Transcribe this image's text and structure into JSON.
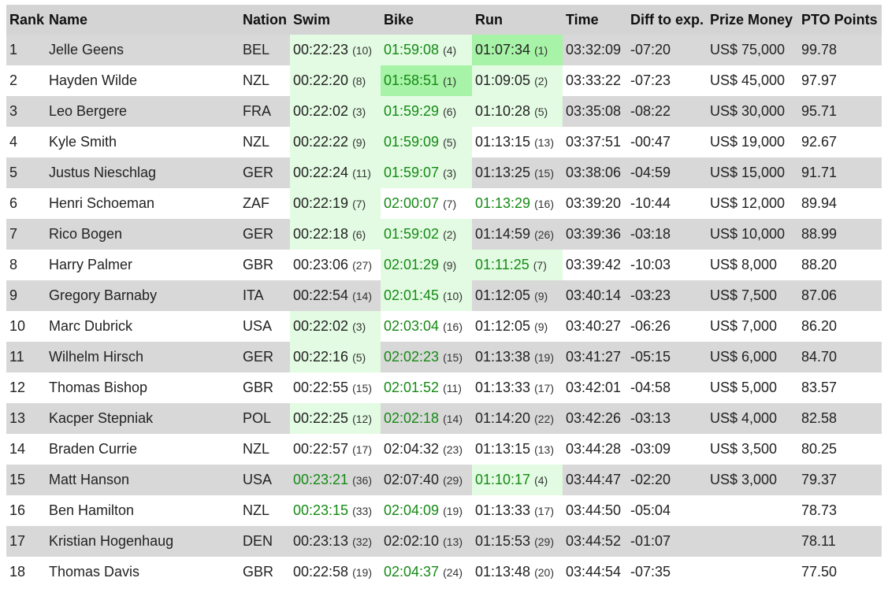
{
  "headers": {
    "rank": "Rank",
    "name": "Name",
    "nation": "Nation",
    "swim": "Swim",
    "bike": "Bike",
    "run": "Run",
    "time": "Time",
    "diff": "Diff to exp.",
    "prize": "Prize Money",
    "pto": "PTO Points"
  },
  "rows": [
    {
      "rank": "1",
      "name": "Jelle Geens",
      "nation": "BEL",
      "swim": "00:22:23",
      "swim_pos": "(10)",
      "bike": "01:59:08",
      "bike_pos": "(4)",
      "run": "01:07:34",
      "run_pos": "(1)",
      "time": "03:32:09",
      "diff": "-07:20",
      "prize": "US$ 75,000",
      "pto": "99.78"
    },
    {
      "rank": "2",
      "name": "Hayden Wilde",
      "nation": "NZL",
      "swim": "00:22:20",
      "swim_pos": "(8)",
      "bike": "01:58:51",
      "bike_pos": "(1)",
      "run": "01:09:05",
      "run_pos": "(2)",
      "time": "03:33:22",
      "diff": "-07:23",
      "prize": "US$ 45,000",
      "pto": "97.97"
    },
    {
      "rank": "3",
      "name": "Leo Bergere",
      "nation": "FRA",
      "swim": "00:22:02",
      "swim_pos": "(3)",
      "bike": "01:59:29",
      "bike_pos": "(6)",
      "run": "01:10:28",
      "run_pos": "(5)",
      "time": "03:35:08",
      "diff": "-08:22",
      "prize": "US$ 30,000",
      "pto": "95.71"
    },
    {
      "rank": "4",
      "name": "Kyle Smith",
      "nation": "NZL",
      "swim": "00:22:22",
      "swim_pos": "(9)",
      "bike": "01:59:09",
      "bike_pos": "(5)",
      "run": "01:13:15",
      "run_pos": "(13)",
      "time": "03:37:51",
      "diff": "-00:47",
      "prize": "US$ 19,000",
      "pto": "92.67"
    },
    {
      "rank": "5",
      "name": "Justus Nieschlag",
      "nation": "GER",
      "swim": "00:22:24",
      "swim_pos": "(11)",
      "bike": "01:59:07",
      "bike_pos": "(3)",
      "run": "01:13:25",
      "run_pos": "(15)",
      "time": "03:38:06",
      "diff": "-04:59",
      "prize": "US$ 15,000",
      "pto": "91.71"
    },
    {
      "rank": "6",
      "name": "Henri Schoeman",
      "nation": "ZAF",
      "swim": "00:22:19",
      "swim_pos": "(7)",
      "bike": "02:00:07",
      "bike_pos": "(7)",
      "run": "01:13:29",
      "run_pos": "(16)",
      "time": "03:39:20",
      "diff": "-10:44",
      "prize": "US$ 12,000",
      "pto": "89.94"
    },
    {
      "rank": "7",
      "name": "Rico Bogen",
      "nation": "GER",
      "swim": "00:22:18",
      "swim_pos": "(6)",
      "bike": "01:59:02",
      "bike_pos": "(2)",
      "run": "01:14:59",
      "run_pos": "(26)",
      "time": "03:39:36",
      "diff": "-03:18",
      "prize": "US$ 10,000",
      "pto": "88.99"
    },
    {
      "rank": "8",
      "name": "Harry Palmer",
      "nation": "GBR",
      "swim": "00:23:06",
      "swim_pos": "(27)",
      "bike": "02:01:29",
      "bike_pos": "(9)",
      "run": "01:11:25",
      "run_pos": "(7)",
      "time": "03:39:42",
      "diff": "-10:03",
      "prize": "US$ 8,000",
      "pto": "88.20"
    },
    {
      "rank": "9",
      "name": "Gregory Barnaby",
      "nation": "ITA",
      "swim": "00:22:54",
      "swim_pos": "(14)",
      "bike": "02:01:45",
      "bike_pos": "(10)",
      "run": "01:12:05",
      "run_pos": "(9)",
      "time": "03:40:14",
      "diff": "-03:23",
      "prize": "US$ 7,500",
      "pto": "87.06"
    },
    {
      "rank": "10",
      "name": "Marc Dubrick",
      "nation": "USA",
      "swim": "00:22:02",
      "swim_pos": "(3)",
      "bike": "02:03:04",
      "bike_pos": "(16)",
      "run": "01:12:05",
      "run_pos": "(9)",
      "time": "03:40:27",
      "diff": "-06:26",
      "prize": "US$ 7,000",
      "pto": "86.20"
    },
    {
      "rank": "11",
      "name": "Wilhelm Hirsch",
      "nation": "GER",
      "swim": "00:22:16",
      "swim_pos": "(5)",
      "bike": "02:02:23",
      "bike_pos": "(15)",
      "run": "01:13:38",
      "run_pos": "(19)",
      "time": "03:41:27",
      "diff": "-05:15",
      "prize": "US$ 6,000",
      "pto": "84.70"
    },
    {
      "rank": "12",
      "name": "Thomas Bishop",
      "nation": "GBR",
      "swim": "00:22:55",
      "swim_pos": "(15)",
      "bike": "02:01:52",
      "bike_pos": "(11)",
      "run": "01:13:33",
      "run_pos": "(17)",
      "time": "03:42:01",
      "diff": "-04:58",
      "prize": "US$ 5,000",
      "pto": "83.57"
    },
    {
      "rank": "13",
      "name": "Kacper Stepniak",
      "nation": "POL",
      "swim": "00:22:25",
      "swim_pos": "(12)",
      "bike": "02:02:18",
      "bike_pos": "(14)",
      "run": "01:14:20",
      "run_pos": "(22)",
      "time": "03:42:26",
      "diff": "-03:13",
      "prize": "US$ 4,000",
      "pto": "82.58"
    },
    {
      "rank": "14",
      "name": "Braden Currie",
      "nation": "NZL",
      "swim": "00:22:57",
      "swim_pos": "(17)",
      "bike": "02:04:32",
      "bike_pos": "(23)",
      "run": "01:13:15",
      "run_pos": "(13)",
      "time": "03:44:28",
      "diff": "-03:09",
      "prize": "US$ 3,500",
      "pto": "80.25"
    },
    {
      "rank": "15",
      "name": "Matt Hanson",
      "nation": "USA",
      "swim": "00:23:21",
      "swim_pos": "(36)",
      "bike": "02:07:40",
      "bike_pos": "(29)",
      "run": "01:10:17",
      "run_pos": "(4)",
      "time": "03:44:47",
      "diff": "-02:20",
      "prize": "US$ 3,000",
      "pto": "79.37"
    },
    {
      "rank": "16",
      "name": "Ben Hamilton",
      "nation": "NZL",
      "swim": "00:23:15",
      "swim_pos": "(33)",
      "bike": "02:04:09",
      "bike_pos": "(19)",
      "run": "01:13:33",
      "run_pos": "(17)",
      "time": "03:44:50",
      "diff": "-05:04",
      "prize": "",
      "pto": "78.73"
    },
    {
      "rank": "17",
      "name": "Kristian Hogenhaug",
      "nation": "DEN",
      "swim": "00:23:13",
      "swim_pos": "(32)",
      "bike": "02:02:10",
      "bike_pos": "(13)",
      "run": "01:15:53",
      "run_pos": "(29)",
      "time": "03:44:52",
      "diff": "-01:07",
      "prize": "",
      "pto": "78.11"
    },
    {
      "rank": "18",
      "name": "Thomas Davis",
      "nation": "GBR",
      "swim": "00:22:58",
      "swim_pos": "(19)",
      "bike": "02:04:37",
      "bike_pos": "(24)",
      "run": "01:13:48",
      "run_pos": "(20)",
      "time": "03:44:54",
      "diff": "-07:35",
      "prize": "",
      "pto": "77.50"
    }
  ]
}
